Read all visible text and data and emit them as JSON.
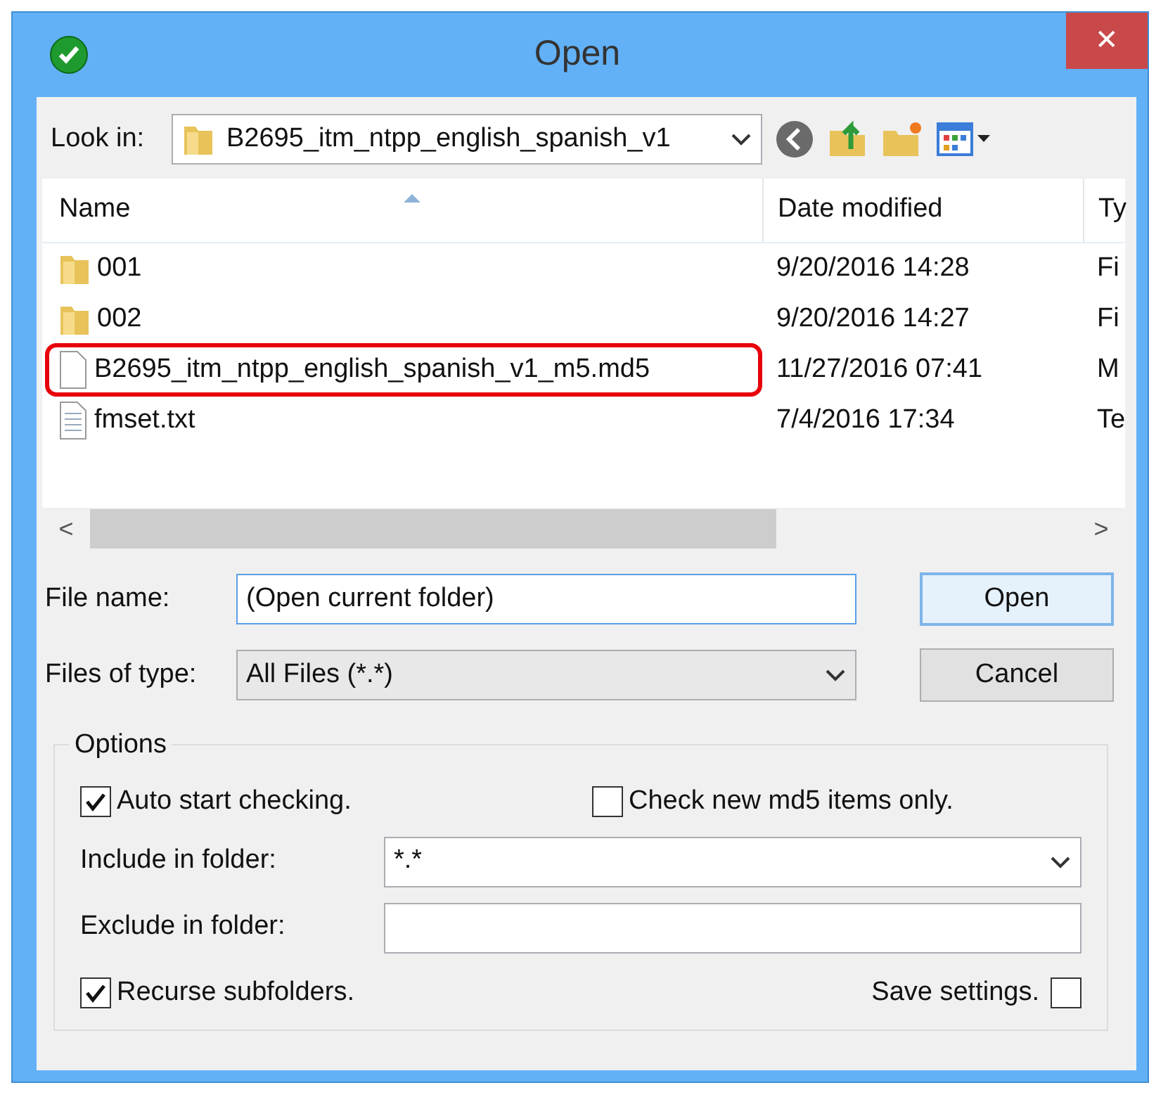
{
  "window": {
    "title": "Open",
    "close": "✕"
  },
  "look_in": {
    "label": "Look in:",
    "value": "B2695_itm_ntpp_english_spanish_v1"
  },
  "columns": [
    {
      "label": "Name",
      "sorted": true
    },
    {
      "label": "Date modified",
      "sorted": false
    },
    {
      "label": "Ty",
      "sorted": false
    }
  ],
  "files": [
    {
      "kind": "folder",
      "name": "001",
      "date": "9/20/2016 14:28",
      "type": "Fi",
      "highlighted": false
    },
    {
      "kind": "folder",
      "name": "002",
      "date": "9/20/2016 14:27",
      "type": "Fi",
      "highlighted": false
    },
    {
      "kind": "file",
      "name": "B2695_itm_ntpp_english_spanish_v1_m5.md5",
      "date": "11/27/2016 07:41",
      "type": "M",
      "highlighted": true
    },
    {
      "kind": "text",
      "name": "fmset.txt",
      "date": "7/4/2016 17:34",
      "type": "Te",
      "highlighted": false
    }
  ],
  "scrollbar": {
    "left": "<",
    "right": ">"
  },
  "file_name": {
    "label": "File name:",
    "value": "(Open current folder)"
  },
  "file_type": {
    "label": "Files of type:",
    "value": "All Files (*.*)"
  },
  "buttons": [
    "Open",
    "Cancel"
  ],
  "options": {
    "title": "Options",
    "auto_start": {
      "label": "Auto start checking.",
      "checked": true
    },
    "check_new": {
      "label": "Check new md5 items only.",
      "checked": false
    },
    "include": {
      "label": "Include in folder:",
      "value": "*.*"
    },
    "exclude": {
      "label": "Exclude in folder:"
    },
    "recurse": {
      "label": "Recurse subfolders.",
      "checked": true
    },
    "save": {
      "label": "Save settings.",
      "checked": false
    }
  }
}
